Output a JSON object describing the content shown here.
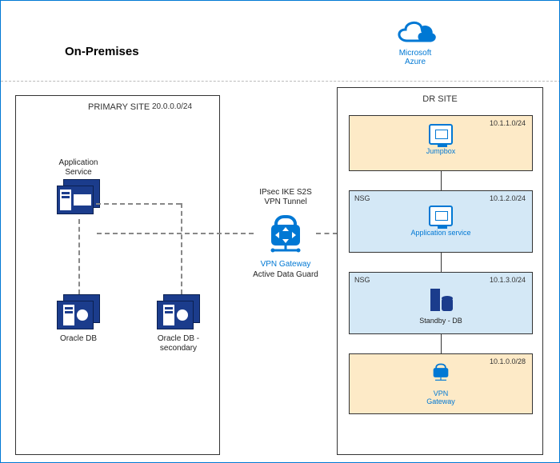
{
  "header": {
    "onprem_title": "On-Premises",
    "cloud_label_line1": "Microsoft",
    "cloud_label_line2": "Azure"
  },
  "primary": {
    "title": "PRIMARY SITE",
    "cidr": "20.0.0.0/24",
    "app_label_line1": "Application",
    "app_label_line2": "Service",
    "db1_label": "Oracle DB",
    "db2_label_line1": "Oracle DB -",
    "db2_label_line2": "secondary"
  },
  "center": {
    "tunnel_line1": "IPsec IKE S2S",
    "tunnel_line2": "VPN Tunnel",
    "gateway_label": "VPN Gateway",
    "adg_label": "Active Data Guard"
  },
  "dr": {
    "title": "DR SITE",
    "subnets": [
      {
        "nsg": "",
        "cidr": "10.1.1.0/24",
        "caption": "Jumpbox",
        "type": "vm",
        "bg": "beige"
      },
      {
        "nsg": "NSG",
        "cidr": "10.1.2.0/24",
        "caption": "Application service",
        "type": "vm",
        "bg": "blue"
      },
      {
        "nsg": "NSG",
        "cidr": "10.1.3.0/24",
        "caption": "Standby - DB",
        "type": "db",
        "bg": "blue"
      },
      {
        "nsg": "",
        "cidr": "10.1.0.0/28",
        "caption_line1": "VPN",
        "caption_line2": "Gateway",
        "type": "vpn",
        "bg": "beige"
      }
    ]
  }
}
